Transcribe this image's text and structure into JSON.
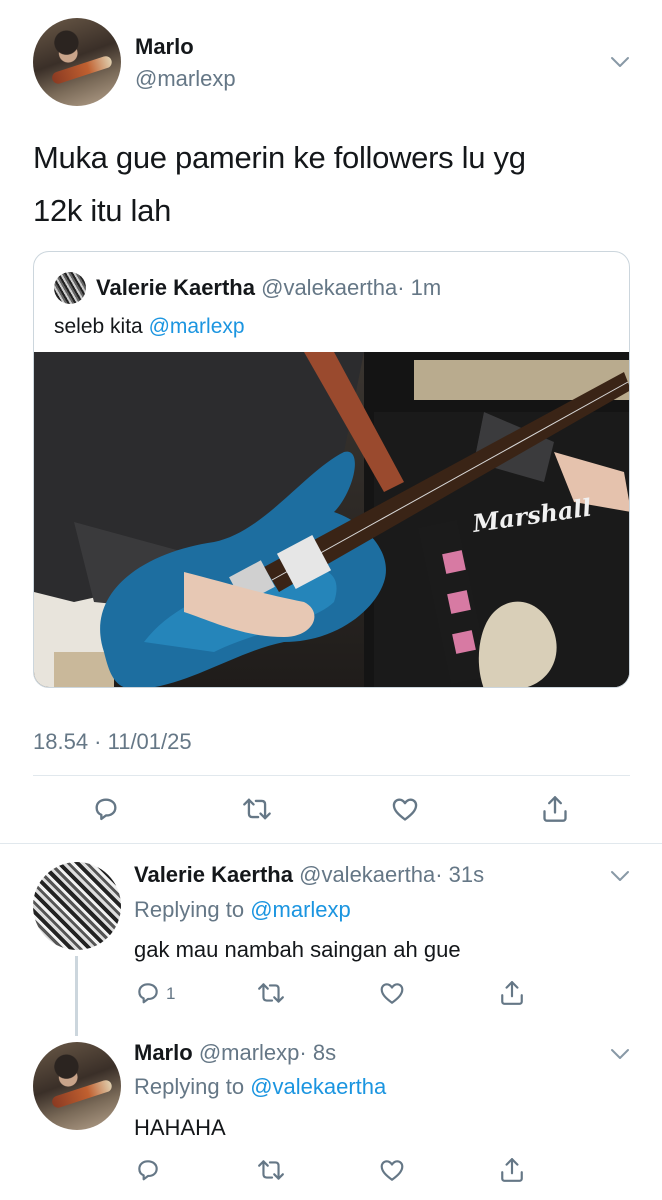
{
  "main_tweet": {
    "name": "Marlo",
    "handle": "@marlexp",
    "text_line1": "Muka gue pamerin ke followers lu yg",
    "text_line2": "12k itu lah",
    "timestamp": "18.54 · 11/01/25"
  },
  "quoted_tweet": {
    "name": "Valerie Kaertha",
    "handle": "@valekaertha",
    "time": "· 1m",
    "text_prefix": "seleb kita ",
    "mention": "@marlexp",
    "image_sign": "Marshall"
  },
  "replies": [
    {
      "name": "Valerie Kaertha",
      "handle": "@valekaertha",
      "time": "· 31s",
      "replying_prefix": "Replying to ",
      "replying_to": "@marlexp",
      "text": "gak mau nambah saingan ah gue",
      "reply_count": "1"
    },
    {
      "name": "Marlo",
      "handle": "@marlexp",
      "time": "· 8s",
      "replying_prefix": "Replying to ",
      "replying_to": "@valekaertha",
      "text": "HAHAHA",
      "reply_count": ""
    }
  ],
  "colors": {
    "link": "#1b95e0",
    "secondary_text": "#657786",
    "border": "#e1e8ed"
  },
  "icons": [
    "chevron-down-icon",
    "reply-icon",
    "retweet-icon",
    "like-icon",
    "share-icon"
  ]
}
